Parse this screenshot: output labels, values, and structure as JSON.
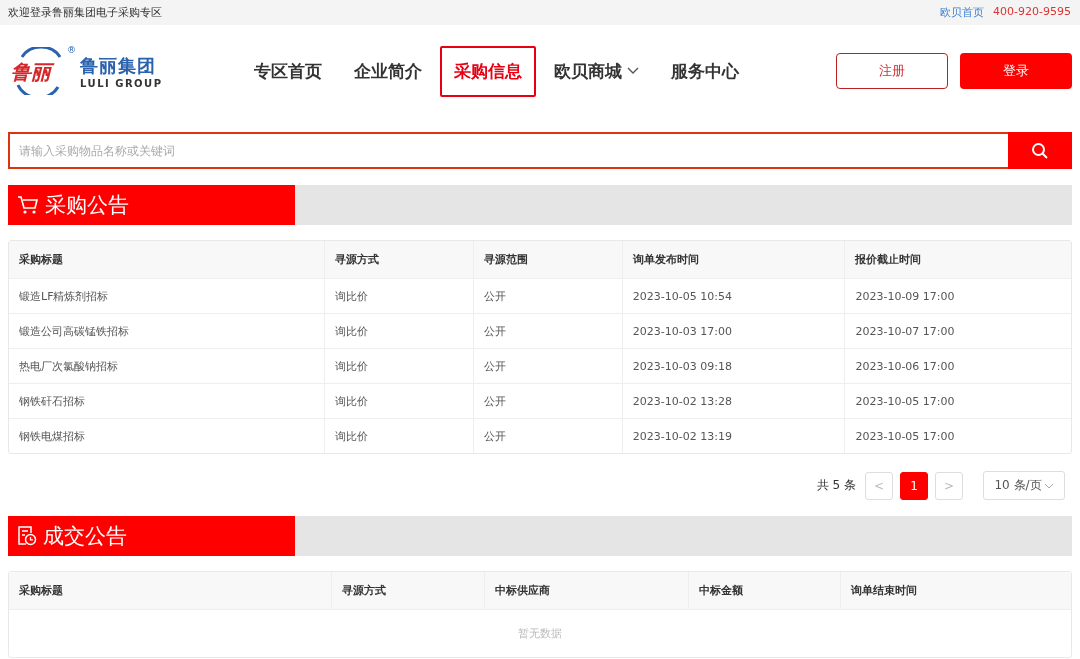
{
  "top_bar": {
    "welcome": "欢迎登录鲁丽集团电子采购专区",
    "home_link": "欧贝首页",
    "phone": "400-920-9595"
  },
  "logo": {
    "mark": "鲁丽",
    "name": "鲁丽集团",
    "name_en": "LULI GROUP",
    "registered": "®"
  },
  "nav": [
    {
      "label": "专区首页",
      "selected": false,
      "dropdown": false
    },
    {
      "label": "企业简介",
      "selected": false,
      "dropdown": false
    },
    {
      "label": "采购信息",
      "selected": true,
      "dropdown": false
    },
    {
      "label": "欧贝商城",
      "selected": false,
      "dropdown": true
    },
    {
      "label": "服务中心",
      "selected": false,
      "dropdown": false
    }
  ],
  "buttons": [
    {
      "label": "注册",
      "kind": "outline"
    },
    {
      "label": "登录",
      "kind": "primary"
    }
  ],
  "search": {
    "placeholder": "请输入采购物品名称或关键词"
  },
  "procurement": {
    "title": "采购公告",
    "columns": [
      "采购标题",
      "寻源方式",
      "寻源范围",
      "询单发布时间",
      "报价截止时间"
    ],
    "rows": [
      [
        "锻造LF精炼剂招标",
        "询比价",
        "公开",
        "2023-10-05 10:54",
        "2023-10-09 17:00"
      ],
      [
        "锻造公司高碳锰铁招标",
        "询比价",
        "公开",
        "2023-10-03 17:00",
        "2023-10-07 17:00"
      ],
      [
        "热电厂次氯酸钠招标",
        "询比价",
        "公开",
        "2023-10-03 09:18",
        "2023-10-06 17:00"
      ],
      [
        "钢铁矸石招标",
        "询比价",
        "公开",
        "2023-10-02 13:28",
        "2023-10-05 17:00"
      ],
      [
        "钢铁电煤招标",
        "询比价",
        "公开",
        "2023-10-02 13:19",
        "2023-10-05 17:00"
      ]
    ],
    "pagination": {
      "total": "共 5 条",
      "prev": "<",
      "pages": [
        {
          "label": "1",
          "selected": true
        }
      ],
      "next": ">",
      "page_size": "10 条/页"
    }
  },
  "deals": {
    "title": "成交公告",
    "columns": [
      "采购标题",
      "寻源方式",
      "中标供应商",
      "中标金额",
      "询单结束时间"
    ],
    "empty": "暂无数据"
  }
}
